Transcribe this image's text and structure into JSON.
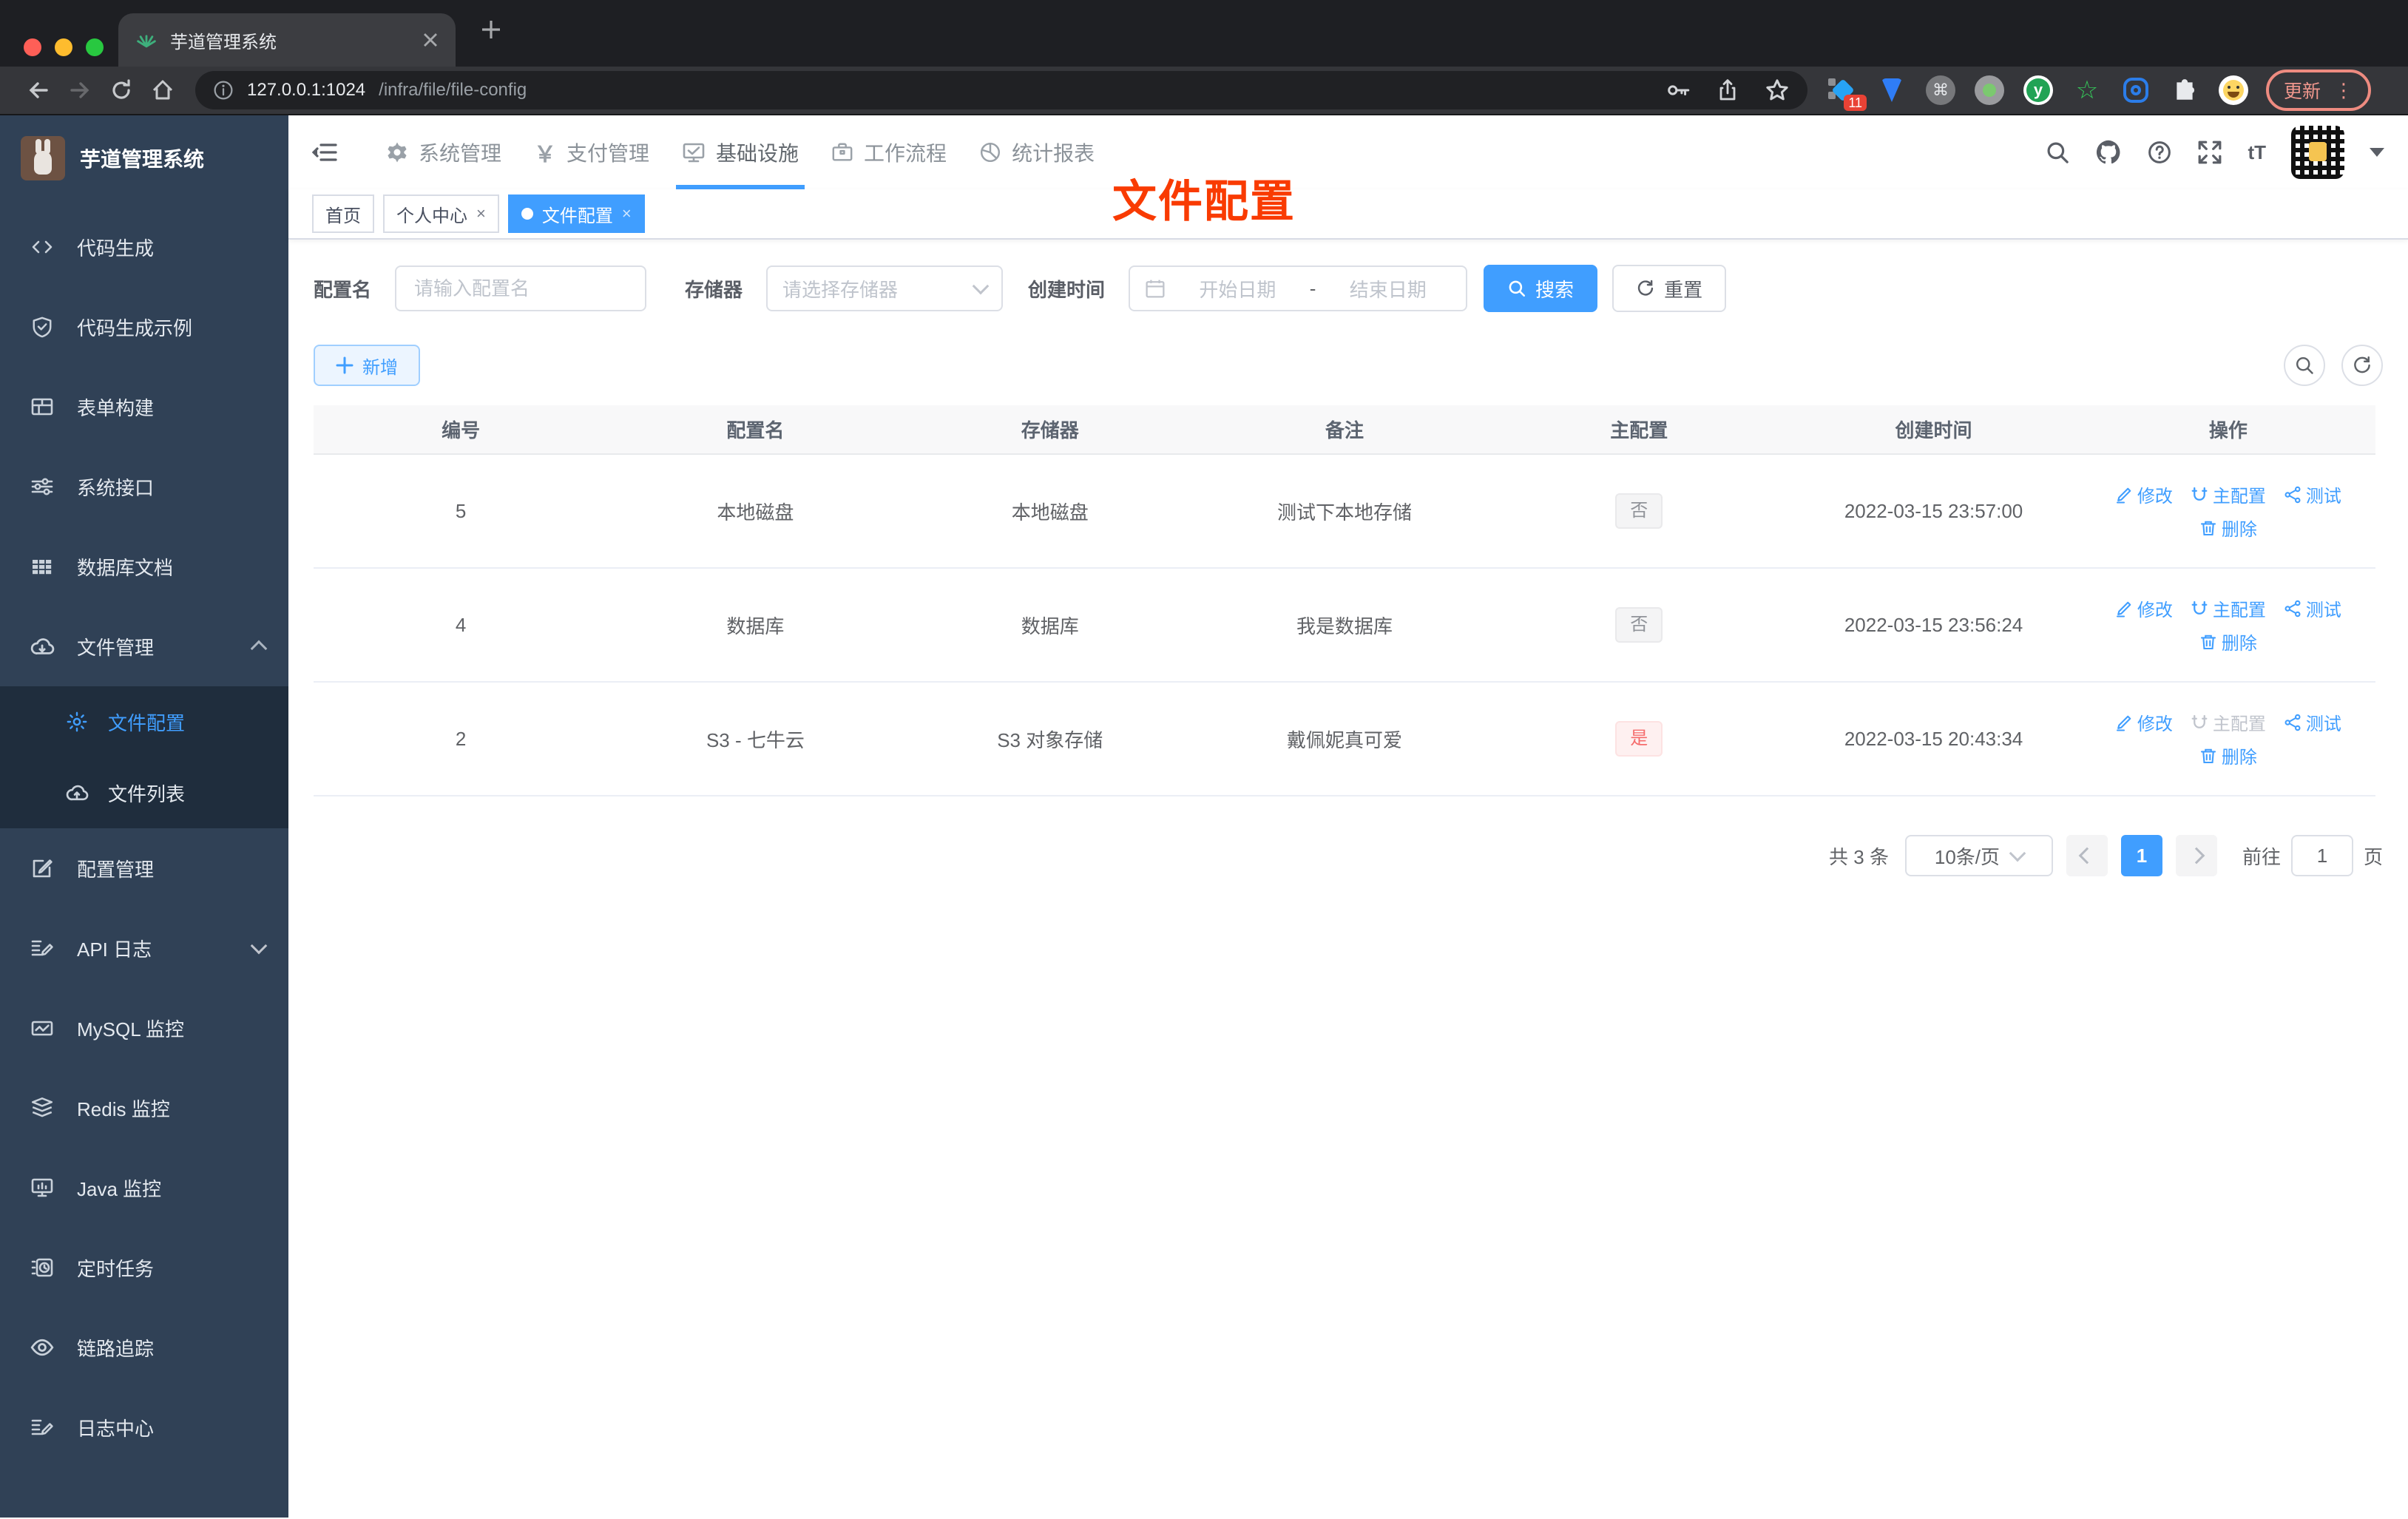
{
  "browser": {
    "tab_title": "芋道管理系统",
    "url_host": "127.0.0.1:1024",
    "url_path": "/infra/file/file-config",
    "ext_badge": "11",
    "update_label": "更新"
  },
  "sidebar": {
    "logo_title": "芋道管理系统",
    "items": [
      {
        "label": "代码生成"
      },
      {
        "label": "代码生成示例"
      },
      {
        "label": "表单构建"
      },
      {
        "label": "系统接口"
      },
      {
        "label": "数据库文档"
      },
      {
        "label": "文件管理"
      },
      {
        "label": "配置管理"
      },
      {
        "label": "API 日志"
      },
      {
        "label": "MySQL 监控"
      },
      {
        "label": "Redis 监控"
      },
      {
        "label": "Java 监控"
      },
      {
        "label": "定时任务"
      },
      {
        "label": "链路追踪"
      },
      {
        "label": "日志中心"
      }
    ],
    "submenu": [
      {
        "label": "文件配置"
      },
      {
        "label": "文件列表"
      }
    ]
  },
  "topnav": {
    "items": [
      {
        "label": "系统管理"
      },
      {
        "label": "支付管理"
      },
      {
        "label": "基础设施"
      },
      {
        "label": "工作流程"
      },
      {
        "label": "统计报表"
      }
    ]
  },
  "tabs": [
    {
      "label": "首页"
    },
    {
      "label": "个人中心"
    },
    {
      "label": "文件配置"
    }
  ],
  "annotation": "文件配置",
  "form": {
    "config_name_label": "配置名",
    "config_name_placeholder": "请输入配置名",
    "storage_label": "存储器",
    "storage_placeholder": "请选择存储器",
    "create_time_label": "创建时间",
    "start_placeholder": "开始日期",
    "range_separator": "-",
    "end_placeholder": "结束日期",
    "search_label": "搜索",
    "reset_label": "重置"
  },
  "toolbar": {
    "add_label": "新增"
  },
  "table": {
    "columns": [
      "编号",
      "配置名",
      "存储器",
      "备注",
      "主配置",
      "创建时间",
      "操作"
    ],
    "rows": [
      {
        "id": "5",
        "name": "本地磁盘",
        "storage": "本地磁盘",
        "remark": "测试下本地存储",
        "master": "否",
        "created": "2022-03-15 23:57:00"
      },
      {
        "id": "4",
        "name": "数据库",
        "storage": "数据库",
        "remark": "我是数据库",
        "master": "否",
        "created": "2022-03-15 23:56:24"
      },
      {
        "id": "2",
        "name": "S3 - 七牛云",
        "storage": "S3 对象存储",
        "remark": "戴佩妮真可爱",
        "master": "是",
        "created": "2022-03-15 20:43:34"
      }
    ],
    "actions": {
      "edit": "修改",
      "master": "主配置",
      "test": "测试",
      "delete": "删除"
    }
  },
  "pagination": {
    "total": "共 3 条",
    "page_size": "10条/页",
    "current_page": "1",
    "goto_label": "前往",
    "goto_value": "1",
    "page_unit": "页"
  },
  "colors": {
    "accent": "#409eff",
    "danger": "#f56c6c",
    "annotation_red": "#f93b02",
    "sidebar_bg": "#304156",
    "submenu_bg": "#1f2d3d"
  }
}
